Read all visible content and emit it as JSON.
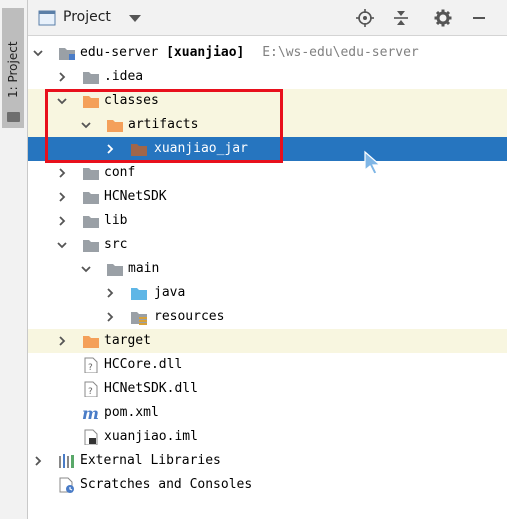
{
  "sidebar": {
    "tab_label": "1: Project"
  },
  "header": {
    "title": "Project",
    "icons": [
      "project-view-icon",
      "dropdown-icon",
      "locate-icon",
      "collapse-all-icon",
      "settings-icon",
      "hide-icon"
    ]
  },
  "tree": {
    "root": {
      "name": "edu-server",
      "module": "[xuanjiao]",
      "path": "E:\\ws-edu\\edu-server"
    },
    "items": [
      {
        "label": "edu-server",
        "kind": "module-folder",
        "expanded": true
      },
      {
        "label": ".idea",
        "kind": "folder-gray",
        "expanded": false
      },
      {
        "label": "classes",
        "kind": "folder-orange",
        "expanded": true
      },
      {
        "label": "artifacts",
        "kind": "folder-orange",
        "expanded": true
      },
      {
        "label": "xuanjiao_jar",
        "kind": "folder-brown",
        "expanded": false
      },
      {
        "label": "conf",
        "kind": "folder-gray",
        "expanded": false
      },
      {
        "label": "HCNetSDK",
        "kind": "folder-gray",
        "expanded": false
      },
      {
        "label": "lib",
        "kind": "folder-gray",
        "expanded": false
      },
      {
        "label": "src",
        "kind": "folder-gray",
        "expanded": true
      },
      {
        "label": "main",
        "kind": "folder-gray",
        "expanded": true
      },
      {
        "label": "java",
        "kind": "folder-blue",
        "expanded": false
      },
      {
        "label": "resources",
        "kind": "folder-resources",
        "expanded": false
      },
      {
        "label": "target",
        "kind": "folder-orange",
        "expanded": false
      },
      {
        "label": "HCCore.dll",
        "kind": "file-unknown"
      },
      {
        "label": "HCNetSDK.dll",
        "kind": "file-unknown"
      },
      {
        "label": "pom.xml",
        "kind": "file-maven"
      },
      {
        "label": "xuanjiao.iml",
        "kind": "file-iml"
      },
      {
        "label": "External Libraries",
        "kind": "libraries",
        "expanded": false
      },
      {
        "label": "Scratches and Consoles",
        "kind": "scratches"
      }
    ],
    "selected": "xuanjiao_jar"
  },
  "colors": {
    "selection": "#2675bf",
    "highlight": "#f8f6e0",
    "annotation": "#e8101c",
    "folder_orange": "#f4a05a",
    "folder_gray": "#9aa0a6",
    "folder_blue": "#5fb6e6"
  }
}
